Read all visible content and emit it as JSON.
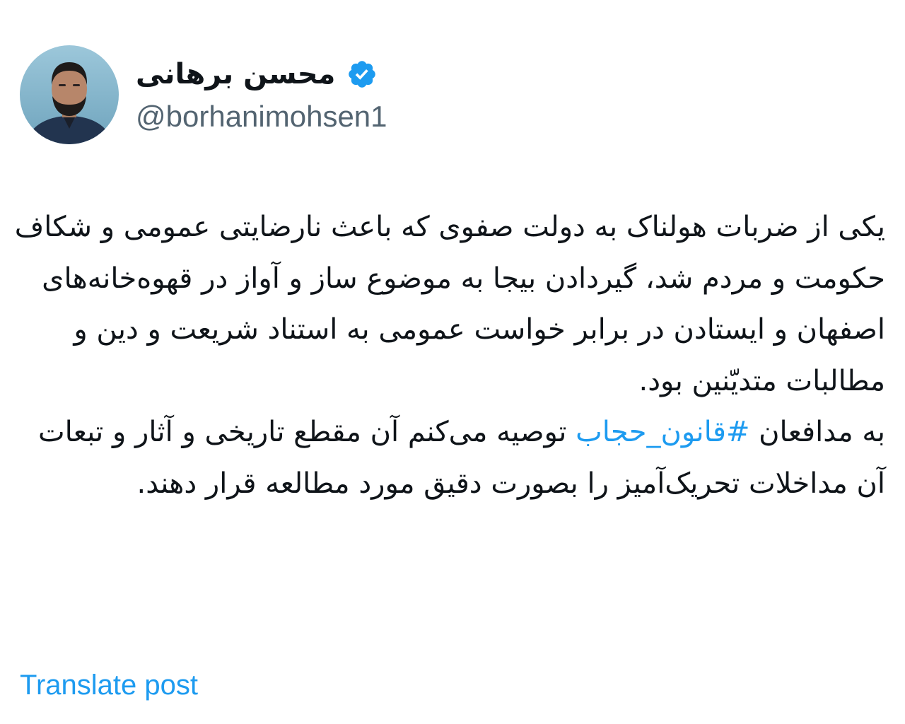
{
  "author": {
    "display_name": "محسن برهانی",
    "handle": "@borhanimohsen1",
    "verified": true,
    "avatar_icon": "profile-photo",
    "verified_icon": "verified-badge-icon"
  },
  "tweet": {
    "paragraph1": "یکی از ضربات هولناک به دولت صفوی که باعث نارضایتی عمومی و شکاف حکومت و مردم شد، گیردادن بیجا به موضوع ساز و آواز در قهوه‌خانه‌های اصفهان و ایستادن در برابر خواست عمومی به استناد شریعت و دین و مطالبات متدیّنین بود.",
    "paragraph2_prefix": "به مدافعان ",
    "hashtag": "#قانون_حجاب",
    "paragraph2_suffix": " توصیه می‌کنم آن مقطع تاریخی و آثار و تبعات آن مداخلات تحریک‌آمیز را بصورت دقیق مورد مطالعه قرار دهند."
  },
  "actions": {
    "translate_label": "Translate post"
  },
  "colors": {
    "link": "#1d9bf0",
    "text": "#0f1419",
    "secondary": "#536471",
    "background": "#ffffff"
  }
}
